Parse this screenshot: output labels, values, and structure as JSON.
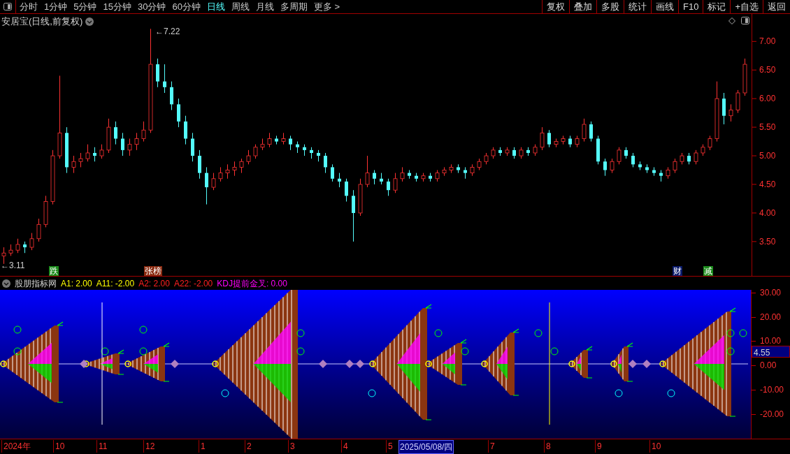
{
  "period_tabs": [
    {
      "label": "分时",
      "selected": false
    },
    {
      "label": "1分钟",
      "selected": false
    },
    {
      "label": "5分钟",
      "selected": false
    },
    {
      "label": "15分钟",
      "selected": false
    },
    {
      "label": "30分钟",
      "selected": false
    },
    {
      "label": "60分钟",
      "selected": false
    },
    {
      "label": "日线",
      "selected": true
    },
    {
      "label": "周线",
      "selected": false
    },
    {
      "label": "月线",
      "selected": false
    },
    {
      "label": "多周期",
      "selected": false
    },
    {
      "label": "更多 >",
      "selected": false
    }
  ],
  "toolbar_buttons": [
    "复权",
    "叠加",
    "多股",
    "统计",
    "画线",
    "F10",
    "标记",
    "+自选",
    "返回"
  ],
  "price_chart": {
    "title": "安居宝(日线,前复权)",
    "high_label": "←7.22",
    "low_label": "←3.11",
    "chart_data": {
      "type": "candlestick",
      "ylim": [
        2.9,
        7.48
      ],
      "yticks": [
        {
          "value": 7,
          "label": "7.00"
        },
        {
          "value": 6.5,
          "label": "6.50"
        },
        {
          "value": 6,
          "label": "6.00"
        },
        {
          "value": 5.5,
          "label": "5.50"
        },
        {
          "value": 5,
          "label": "5.00"
        },
        {
          "value": 4.5,
          "label": "4.50"
        },
        {
          "value": 4,
          "label": "4.00"
        },
        {
          "value": 3.5,
          "label": "3.50"
        }
      ],
      "ohlc": [
        [
          3.25,
          3.4,
          3.11,
          3.3
        ],
        [
          3.3,
          3.45,
          3.25,
          3.35
        ],
        [
          3.35,
          3.55,
          3.3,
          3.45
        ],
        [
          3.45,
          3.5,
          3.3,
          3.4
        ],
        [
          3.4,
          3.65,
          3.35,
          3.55
        ],
        [
          3.55,
          3.9,
          3.5,
          3.8
        ],
        [
          3.8,
          4.3,
          3.75,
          4.2
        ],
        [
          4.2,
          5.1,
          4.15,
          5.0
        ],
        [
          5.0,
          6.4,
          4.95,
          5.4
        ],
        [
          5.4,
          5.5,
          4.7,
          4.8
        ],
        [
          4.8,
          5.0,
          4.7,
          4.9
        ],
        [
          4.9,
          5.05,
          4.8,
          4.95
        ],
        [
          4.95,
          5.2,
          4.9,
          5.05
        ],
        [
          5.05,
          5.15,
          4.9,
          5.0
        ],
        [
          5.0,
          5.2,
          4.95,
          5.1
        ],
        [
          5.1,
          5.65,
          5.05,
          5.5
        ],
        [
          5.5,
          5.6,
          5.2,
          5.3
        ],
        [
          5.3,
          5.4,
          5.0,
          5.1
        ],
        [
          5.1,
          5.3,
          5.0,
          5.2
        ],
        [
          5.2,
          5.4,
          5.1,
          5.3
        ],
        [
          5.3,
          5.6,
          5.25,
          5.45
        ],
        [
          5.45,
          7.22,
          5.4,
          6.6
        ],
        [
          6.6,
          6.7,
          6.2,
          6.3
        ],
        [
          6.3,
          6.6,
          6.1,
          6.2
        ],
        [
          6.2,
          6.3,
          5.8,
          5.9
        ],
        [
          5.9,
          6.0,
          5.5,
          5.6
        ],
        [
          5.6,
          5.7,
          5.2,
          5.3
        ],
        [
          5.3,
          5.4,
          4.9,
          5.0
        ],
        [
          5.0,
          5.1,
          4.6,
          4.7
        ],
        [
          4.7,
          4.8,
          4.15,
          4.45
        ],
        [
          4.45,
          4.7,
          4.4,
          4.6
        ],
        [
          4.6,
          4.8,
          4.55,
          4.7
        ],
        [
          4.7,
          4.85,
          4.6,
          4.75
        ],
        [
          4.75,
          4.9,
          4.65,
          4.8
        ],
        [
          4.8,
          4.95,
          4.7,
          4.9
        ],
        [
          4.9,
          5.1,
          4.85,
          5.0
        ],
        [
          5.0,
          5.2,
          4.95,
          5.15
        ],
        [
          5.15,
          5.3,
          5.1,
          5.2
        ],
        [
          5.2,
          5.4,
          5.15,
          5.3
        ],
        [
          5.3,
          5.35,
          5.2,
          5.25
        ],
        [
          5.25,
          5.4,
          5.2,
          5.3
        ],
        [
          5.3,
          5.35,
          5.1,
          5.2
        ],
        [
          5.2,
          5.25,
          5.05,
          5.15
        ],
        [
          5.15,
          5.2,
          5.0,
          5.1
        ],
        [
          5.1,
          5.15,
          4.95,
          5.05
        ],
        [
          5.05,
          5.1,
          4.9,
          5.0
        ],
        [
          5.0,
          5.05,
          4.7,
          4.8
        ],
        [
          4.8,
          4.85,
          4.55,
          4.6
        ],
        [
          4.6,
          4.7,
          4.45,
          4.55
        ],
        [
          4.55,
          4.6,
          4.2,
          4.3
        ],
        [
          4.3,
          4.4,
          3.5,
          4.0
        ],
        [
          4.0,
          4.6,
          3.95,
          4.5
        ],
        [
          4.5,
          5.0,
          4.45,
          4.7
        ],
        [
          4.7,
          4.75,
          4.5,
          4.6
        ],
        [
          4.6,
          4.7,
          4.5,
          4.55
        ],
        [
          4.55,
          4.6,
          4.3,
          4.4
        ],
        [
          4.4,
          4.7,
          4.35,
          4.6
        ],
        [
          4.6,
          4.8,
          4.55,
          4.7
        ],
        [
          4.7,
          4.75,
          4.6,
          4.65
        ],
        [
          4.65,
          4.7,
          4.55,
          4.6
        ],
        [
          4.6,
          4.7,
          4.55,
          4.65
        ],
        [
          4.65,
          4.7,
          4.55,
          4.6
        ],
        [
          4.6,
          4.75,
          4.55,
          4.7
        ],
        [
          4.7,
          4.8,
          4.65,
          4.75
        ],
        [
          4.75,
          4.85,
          4.7,
          4.8
        ],
        [
          4.8,
          4.85,
          4.7,
          4.75
        ],
        [
          4.75,
          4.8,
          4.6,
          4.7
        ],
        [
          4.7,
          4.85,
          4.65,
          4.8
        ],
        [
          4.8,
          4.95,
          4.75,
          4.9
        ],
        [
          4.9,
          5.05,
          4.85,
          5.0
        ],
        [
          5.0,
          5.15,
          4.95,
          5.1
        ],
        [
          5.1,
          5.15,
          5.0,
          5.05
        ],
        [
          5.05,
          5.15,
          5.0,
          5.1
        ],
        [
          5.1,
          5.15,
          4.95,
          5.0
        ],
        [
          5.0,
          5.15,
          4.95,
          5.1
        ],
        [
          5.1,
          5.15,
          5.0,
          5.05
        ],
        [
          5.05,
          5.2,
          5.0,
          5.15
        ],
        [
          5.15,
          5.5,
          5.1,
          5.4
        ],
        [
          5.4,
          5.45,
          5.15,
          5.2
        ],
        [
          5.2,
          5.3,
          5.15,
          5.25
        ],
        [
          5.25,
          5.35,
          5.2,
          5.3
        ],
        [
          5.3,
          5.35,
          5.15,
          5.2
        ],
        [
          5.2,
          5.35,
          5.15,
          5.3
        ],
        [
          5.3,
          5.65,
          5.25,
          5.55
        ],
        [
          5.55,
          5.6,
          5.25,
          5.3
        ],
        [
          5.3,
          5.35,
          4.85,
          4.9
        ],
        [
          4.9,
          4.95,
          4.65,
          4.75
        ],
        [
          4.75,
          4.95,
          4.7,
          4.9
        ],
        [
          4.9,
          5.15,
          4.85,
          5.1
        ],
        [
          5.1,
          5.15,
          4.95,
          5.0
        ],
        [
          5.0,
          5.05,
          4.8,
          4.85
        ],
        [
          4.85,
          4.9,
          4.75,
          4.8
        ],
        [
          4.8,
          4.85,
          4.7,
          4.75
        ],
        [
          4.75,
          4.8,
          4.65,
          4.7
        ],
        [
          4.7,
          4.75,
          4.55,
          4.65
        ],
        [
          4.65,
          4.8,
          4.6,
          4.75
        ],
        [
          4.75,
          4.95,
          4.7,
          4.9
        ],
        [
          4.9,
          5.05,
          4.85,
          5.0
        ],
        [
          5.0,
          5.05,
          4.85,
          4.9
        ],
        [
          4.9,
          5.1,
          4.85,
          5.05
        ],
        [
          5.05,
          5.2,
          5.0,
          5.15
        ],
        [
          5.15,
          5.35,
          5.1,
          5.3
        ],
        [
          5.3,
          6.3,
          5.25,
          6.0
        ],
        [
          6.0,
          6.1,
          5.55,
          5.7
        ],
        [
          5.7,
          5.9,
          5.6,
          5.8
        ],
        [
          5.8,
          6.15,
          5.75,
          6.1
        ],
        [
          6.1,
          6.7,
          6.05,
          6.6
        ]
      ]
    },
    "markers": [
      {
        "label": "跌",
        "color": "#1a8a1a"
      },
      {
        "label": "张榜",
        "color": "#8a2a10"
      },
      {
        "label": "财",
        "color": "#0a1a6a"
      },
      {
        "label": "减",
        "color": "#1a8a1a"
      }
    ]
  },
  "indicator": {
    "name": "股朋指标网",
    "legend": [
      {
        "text": "A1: 2.00",
        "color": "#ffff00"
      },
      {
        "text": "A11: -2.00",
        "color": "#ffff00"
      },
      {
        "text": "A2: 2.00",
        "color": "#ff2020"
      },
      {
        "text": "A22: -2.00",
        "color": "#ff2020"
      },
      {
        "text": "KDJ提前金叉: 0.00",
        "color": "#ff00ff"
      }
    ],
    "y_axis": [
      "30.00",
      "20.00",
      "10.00",
      "0.00",
      "-10.00",
      "-20.00"
    ],
    "cursor_value": "4.55"
  },
  "date_axis": {
    "labels": [
      "2024年",
      "10",
      "11",
      "12",
      "1",
      "2",
      "3",
      "4",
      "5",
      "7",
      "8",
      "9",
      "10"
    ],
    "cursor_date": "2025/05/08/四"
  }
}
